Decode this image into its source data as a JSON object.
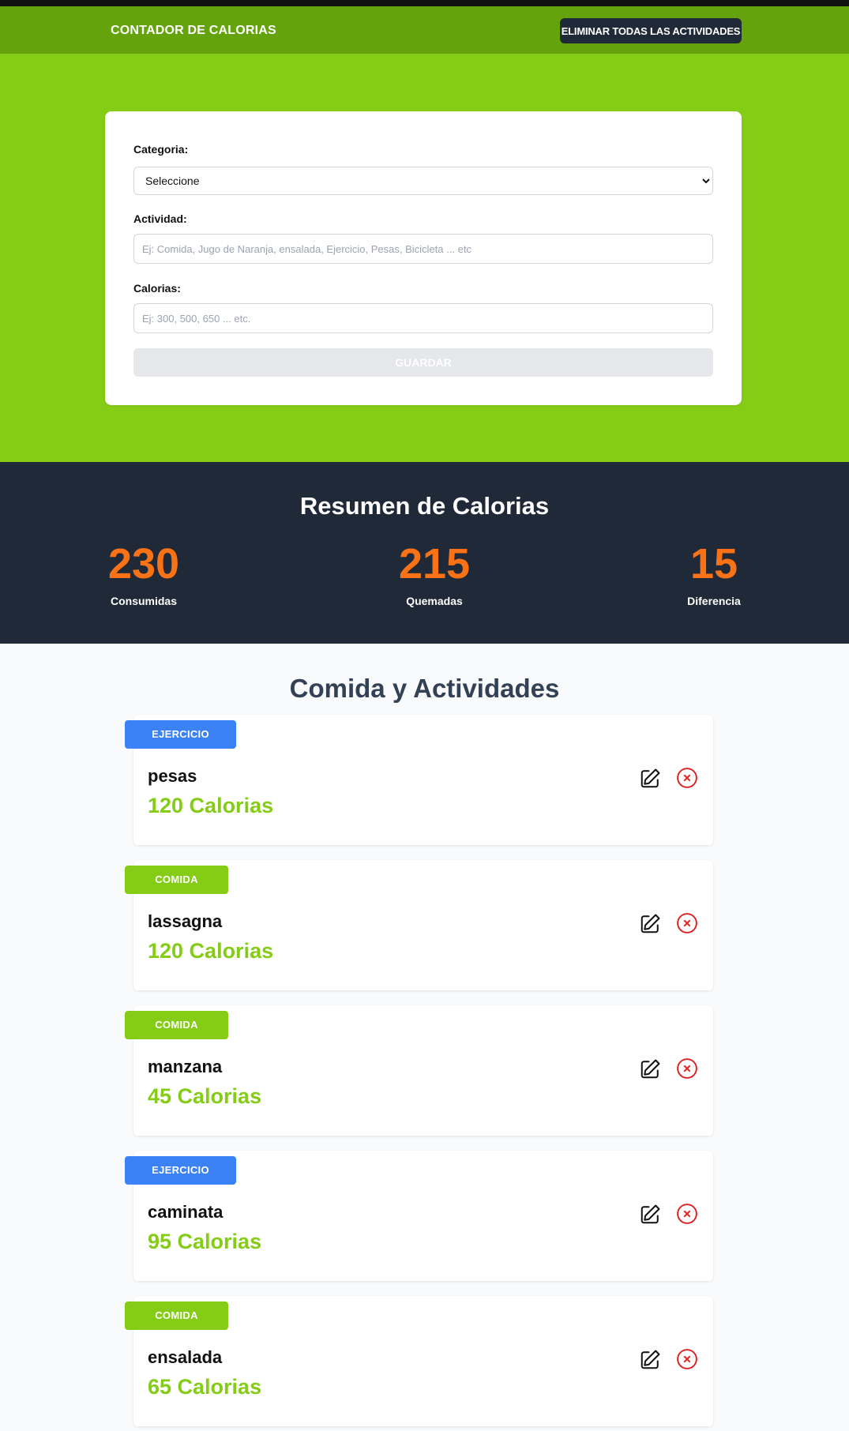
{
  "header": {
    "title": "CONTADOR DE CALORIAS",
    "reset_label": "ELIMINAR TODAS LAS ACTIVIDADES",
    "color": "#65a30d"
  },
  "form": {
    "category_label": "Categoria:",
    "category_value": "Seleccione",
    "activity_label": "Actividad:",
    "activity_placeholder": "Ej: Comida, Jugo de Naranja, ensalada, Ejercicio, Pesas, Bicicleta ... etc",
    "calories_label": "Calorias:",
    "calories_placeholder": "Ej: 300, 500, 650 ... etc.",
    "save_label": "GUARDAR",
    "band_color": "#84cc16"
  },
  "summary": {
    "title": "Resumen de Calorias",
    "stats": [
      {
        "value": "230",
        "label": "Consumidas"
      },
      {
        "value": "215",
        "label": "Quemadas"
      },
      {
        "value": "15",
        "label": "Diferencia"
      }
    ],
    "value_color": "#f97316"
  },
  "activities": {
    "title": "Comida y Actividades",
    "items": [
      {
        "category": "EJERCICIO",
        "name": "pesas",
        "calories": "120 Calorias",
        "edit_icon": "pencil-square-icon",
        "delete_icon": "x-circle-icon"
      },
      {
        "category": "COMIDA",
        "name": "lassagna",
        "calories": "120 Calorias",
        "edit_icon": "pencil-square-icon",
        "delete_icon": "x-circle-icon"
      },
      {
        "category": "COMIDA",
        "name": "manzana",
        "calories": "45 Calorias",
        "edit_icon": "pencil-square-icon",
        "delete_icon": "x-circle-icon"
      },
      {
        "category": "EJERCICIO",
        "name": "caminata",
        "calories": "95 Calorias",
        "edit_icon": "pencil-square-icon",
        "delete_icon": "x-circle-icon"
      },
      {
        "category": "COMIDA",
        "name": "ensalada",
        "calories": "65 Calorias",
        "edit_icon": "pencil-square-icon",
        "delete_icon": "x-circle-icon"
      }
    ]
  }
}
